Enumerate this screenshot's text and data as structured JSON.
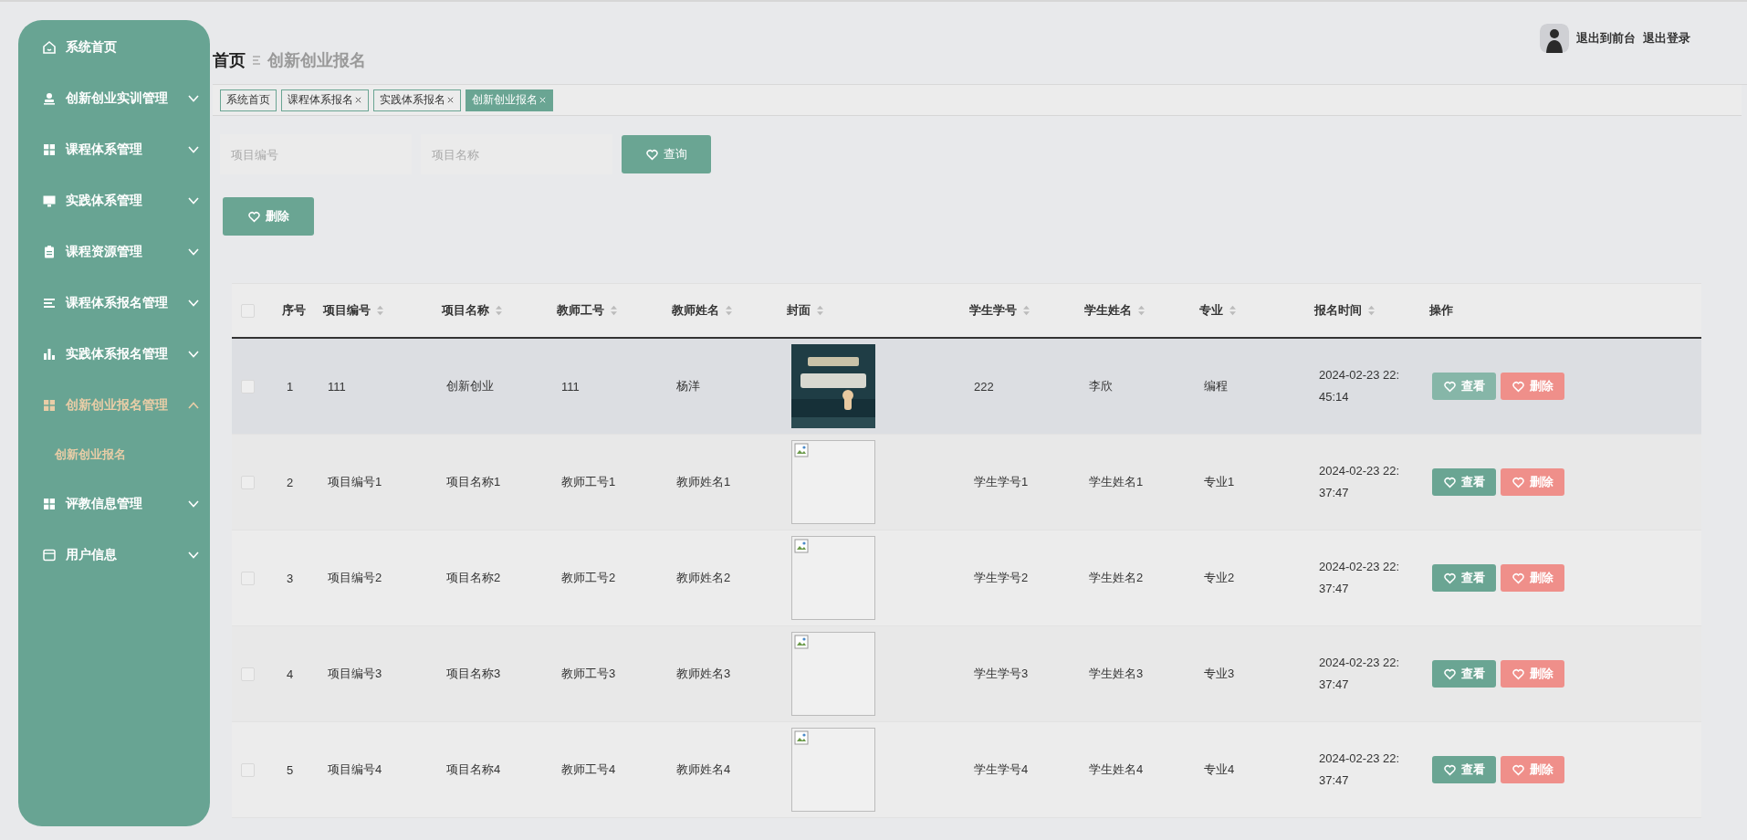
{
  "sidebar": {
    "items": [
      {
        "label": "系统首页",
        "kind": "link",
        "selected": false
      },
      {
        "label": "创新创业实训管理",
        "kind": "group",
        "selected": false,
        "expanded": false
      },
      {
        "label": "课程体系管理",
        "kind": "group",
        "selected": false,
        "expanded": false
      },
      {
        "label": "实践体系管理",
        "kind": "group",
        "selected": false,
        "expanded": false
      },
      {
        "label": "课程资源管理",
        "kind": "group",
        "selected": false,
        "expanded": false
      },
      {
        "label": "课程体系报名管理",
        "kind": "group",
        "selected": false,
        "expanded": false
      },
      {
        "label": "实践体系报名管理",
        "kind": "group",
        "selected": false,
        "expanded": false
      },
      {
        "label": "创新创业报名管理",
        "kind": "group",
        "selected": true,
        "expanded": true,
        "children": [
          {
            "label": "创新创业报名",
            "selected": true
          }
        ]
      },
      {
        "label": "评教信息管理",
        "kind": "group",
        "selected": false,
        "expanded": false
      },
      {
        "label": "用户信息",
        "kind": "group",
        "selected": false,
        "expanded": false
      }
    ]
  },
  "breadcrumb": {
    "home": "首页",
    "current": "创新创业报名"
  },
  "user_links": [
    "退出到前台",
    "退出登录"
  ],
  "tabs": [
    {
      "label": "系统首页",
      "closable": false,
      "selected": false
    },
    {
      "label": "课程体系报名",
      "closable": true,
      "selected": false
    },
    {
      "label": "实践体系报名",
      "closable": true,
      "selected": false
    },
    {
      "label": "创新创业报名",
      "closable": true,
      "selected": true
    }
  ],
  "search": {
    "fields": [
      {
        "placeholder": "项目编号"
      },
      {
        "placeholder": "项目名称"
      }
    ],
    "button": "查询"
  },
  "delete_button": "删除",
  "table": {
    "all_checked": false,
    "columns": [
      {
        "label": "序号",
        "sortable": false
      },
      {
        "label": "项目编号",
        "sortable": true
      },
      {
        "label": "项目名称",
        "sortable": true
      },
      {
        "label": "教师工号",
        "sortable": true
      },
      {
        "label": "教师姓名",
        "sortable": true
      },
      {
        "label": "封面",
        "sortable": true
      },
      {
        "label": "学生学号",
        "sortable": true
      },
      {
        "label": "学生姓名",
        "sortable": true
      },
      {
        "label": "专业",
        "sortable": true
      },
      {
        "label": "报名时间",
        "sortable": true
      },
      {
        "label": "操作",
        "sortable": false
      }
    ],
    "rows": [
      {
        "checked": false,
        "hovered": true,
        "cells": [
          "1",
          "111",
          "创新创业",
          "111",
          "杨洋"
        ],
        "cover": {
          "kind": "picture"
        },
        "cells2": [
          "222",
          "李欣",
          "编程",
          "2024-02-23 22:45:14"
        ],
        "actions": [
          "查看",
          "删除"
        ]
      },
      {
        "checked": false,
        "hovered": false,
        "cells": [
          "2",
          "项目编号1",
          "项目名称1",
          "教师工号1",
          "教师姓名1"
        ],
        "cover": {
          "kind": "broken"
        },
        "cells2": [
          "学生学号1",
          "学生姓名1",
          "专业1",
          "2024-02-23 22:37:47"
        ],
        "actions": [
          "查看",
          "删除"
        ]
      },
      {
        "checked": false,
        "hovered": false,
        "cells": [
          "3",
          "项目编号2",
          "项目名称2",
          "教师工号2",
          "教师姓名2"
        ],
        "cover": {
          "kind": "broken"
        },
        "cells2": [
          "学生学号2",
          "学生姓名2",
          "专业2",
          "2024-02-23 22:37:47"
        ],
        "actions": [
          "查看",
          "删除"
        ]
      },
      {
        "checked": false,
        "hovered": false,
        "cells": [
          "4",
          "项目编号3",
          "项目名称3",
          "教师工号3",
          "教师姓名3"
        ],
        "cover": {
          "kind": "broken"
        },
        "cells2": [
          "学生学号3",
          "学生姓名3",
          "专业3",
          "2024-02-23 22:37:47"
        ],
        "actions": [
          "查看",
          "删除"
        ]
      },
      {
        "checked": false,
        "hovered": false,
        "cells": [
          "5",
          "项目编号4",
          "项目名称4",
          "教师工号4",
          "教师姓名4"
        ],
        "cover": {
          "kind": "broken"
        },
        "cells2": [
          "学生学号4",
          "学生姓名4",
          "专业4",
          "2024-02-23 22:37:47"
        ],
        "actions": [
          "查看",
          "删除"
        ]
      }
    ]
  }
}
